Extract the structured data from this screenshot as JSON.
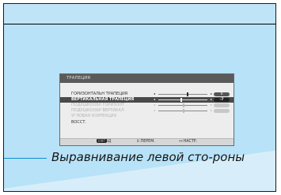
{
  "menu": {
    "title": "ТРАПЕЦИЯ",
    "rows": [
      {
        "label": "ГОРИЗОНТАЛЬН ТРАПЕЦИЯ",
        "value": "0",
        "slider_fraction": 0.58
      },
      {
        "label": "ВЕРТИКАЛЬНАЯ ТРАПЕЦИЯ",
        "value": "-7",
        "slider_fraction": 0.45
      },
      {
        "label": "ПОДУШКООБР ГОРИЗОНТ",
        "value": "",
        "slider_fraction": 0.5
      },
      {
        "label": "ПОДУШКООБР ВЕРТИКАЛ",
        "value": "",
        "slider_fraction": 0.5
      },
      {
        "label": "УГЛОВАЯ КОРРЕКЦИЯ"
      },
      {
        "label": "ВОССТ."
      }
    ],
    "footer": {
      "exit_key": "EXIT",
      "exit_label": "ВЫХОД",
      "move_label": "↕:ПЕРЕМ.",
      "adjust_label": "↔:НАСТР."
    }
  },
  "caption": {
    "text": "Выравнивание левой сто-роны"
  },
  "colors": {
    "background": "#b8e2f8",
    "accent_line": "#0d8fd0"
  }
}
